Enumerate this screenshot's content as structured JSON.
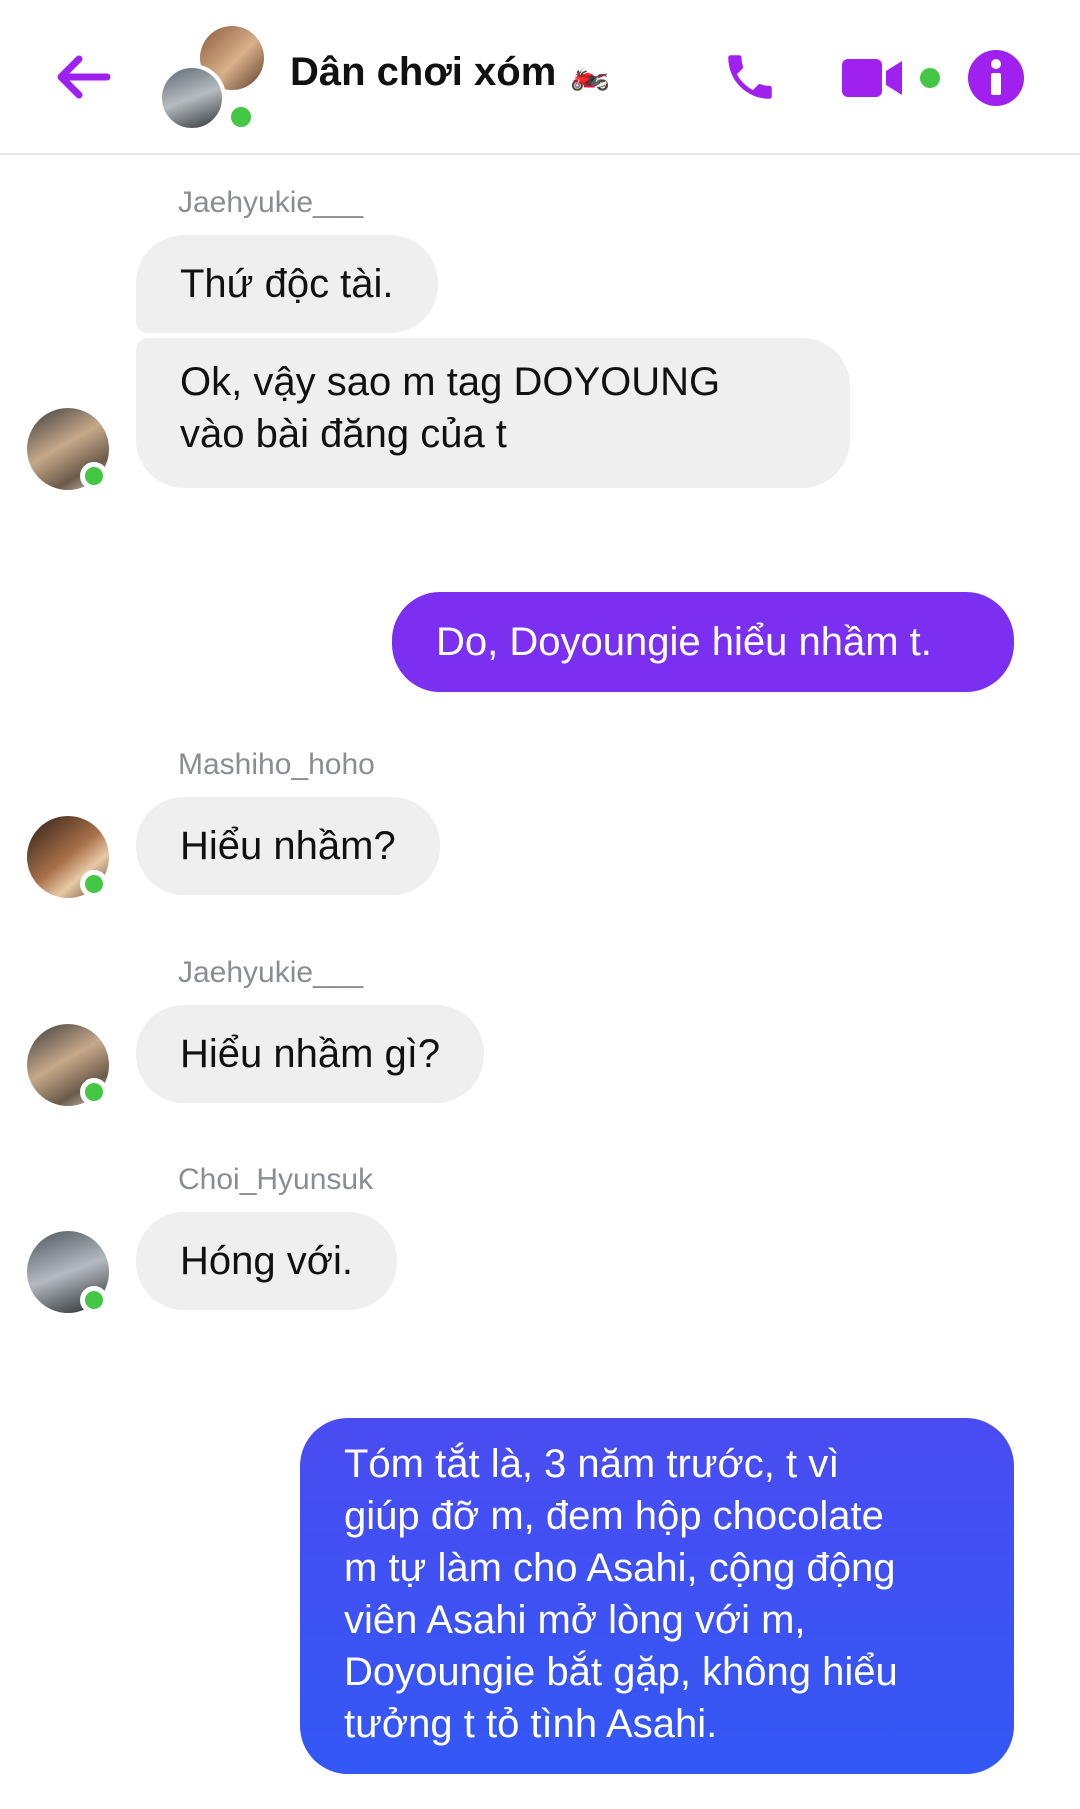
{
  "header": {
    "title": "Dân chơi xóm",
    "title_emoji": "🏍️",
    "accent_color": "#a020f0",
    "online_color": "#44c744"
  },
  "messages": [
    {
      "sender": "Jaehyukie___",
      "text": "Thứ độc tài.",
      "from_me": false
    },
    {
      "sender": "Jaehyukie___",
      "lines": [
        "Ok, vậy sao m tag DOYOUNG",
        "vào bài đăng của t"
      ],
      "from_me": false
    },
    {
      "text": "Do, Doyoungie hiểu nhầm t.",
      "from_me": true
    },
    {
      "sender": "Mashiho_hoho",
      "text": "Hiểu nhầm?",
      "from_me": false
    },
    {
      "sender": "Jaehyukie___",
      "text": "Hiểu nhầm gì?",
      "from_me": false
    },
    {
      "sender": "Choi_Hyunsuk",
      "text": "Hóng với.",
      "from_me": false
    },
    {
      "lines": [
        "Tóm tắt là, 3 năm trước, t vì",
        "giúp đỡ m, đem hộp chocolate",
        "m tự làm cho Asahi, cộng động",
        "viên Asahi mở lòng với m,",
        "Doyoungie bắt gặp, không hiểu",
        "tưởng t tỏ tình Asahi."
      ],
      "from_me": true
    }
  ]
}
